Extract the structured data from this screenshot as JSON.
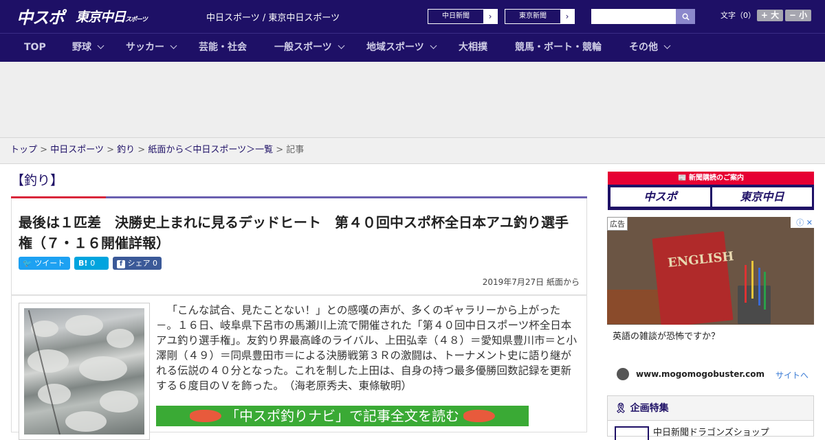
{
  "header": {
    "logo_chuspo": "中スポ",
    "logo_tokyo": "東京中日",
    "logo_tokyo_sub": "スポーツ",
    "site_links": "中日スポーツ / 東京中日スポーツ",
    "paper_buttons": [
      "中日新聞",
      "東京新聞"
    ],
    "search_placeholder": "",
    "text_size_label": "文字（0）",
    "size_up": "+ 大",
    "size_down": "− 小"
  },
  "nav": {
    "items": [
      "TOP",
      "野球",
      "サッカー",
      "芸能・社会",
      "一般スポーツ",
      "地域スポーツ",
      "大相撲",
      "競馬・ボート・競輪",
      "その他"
    ]
  },
  "breadcrumb": {
    "items": [
      "トップ",
      "中日スポーツ",
      "釣り",
      "紙面から＜中日スポーツ＞一覧"
    ],
    "current": "記事",
    "separator": ">"
  },
  "article": {
    "section": "【釣り】",
    "headline": "最後は１匹差　決勝史上まれに見るデッドヒート　第４０回中スポ杯全日本アユ釣り選手権（７・１６開催詳報）",
    "share": {
      "tweet": "ツイート",
      "hatena_count": "0",
      "share_label": "シェア",
      "share_count": "0"
    },
    "date": "2019年7月27日 紙面から",
    "body": "「こんな試合、見たことない！」との感嘆の声が、多くのギャラリーから上がった－。１６日、岐阜県下呂市の馬瀬川上流で開催された「第４０回中日スポーツ杯全日本アユ釣り選手権」。友釣り界最高峰のライバル、上田弘幸（４８）＝愛知県豊川市＝と小澤剛（４９）＝同県豊田市＝による決勝戦第３Ｒの激闘は、トーナメント史に語り継がれる伝説の４０分となった。これを制した上田は、自身の持つ最多優勝回数記録を更新する６度目のＶを飾った。　（海老原秀夫、東條敏明）",
    "navi_banner": "「中スポ釣りナビ」で記事全文を読む"
  },
  "sidebar": {
    "promo_header": "新聞購読のご案内",
    "promo_buttons": [
      "中スポ",
      "東京中日"
    ],
    "ad": {
      "tag": "広告",
      "book_title": "ENGLISH",
      "headline": "英語の雑談が恐怖ですか？",
      "domain": "www.mogomogobuster.com",
      "cta": "サイトへ"
    },
    "feature": {
      "title": "企画特集",
      "item": "中日新聞ドラゴンズショップ"
    }
  },
  "colors": {
    "brand_navy": "#1e1066",
    "accent_red": "#d9263a",
    "navi_green": "#3aaa35",
    "twitter": "#1da1f2",
    "hatena": "#00a4de",
    "facebook": "#3b5998"
  }
}
